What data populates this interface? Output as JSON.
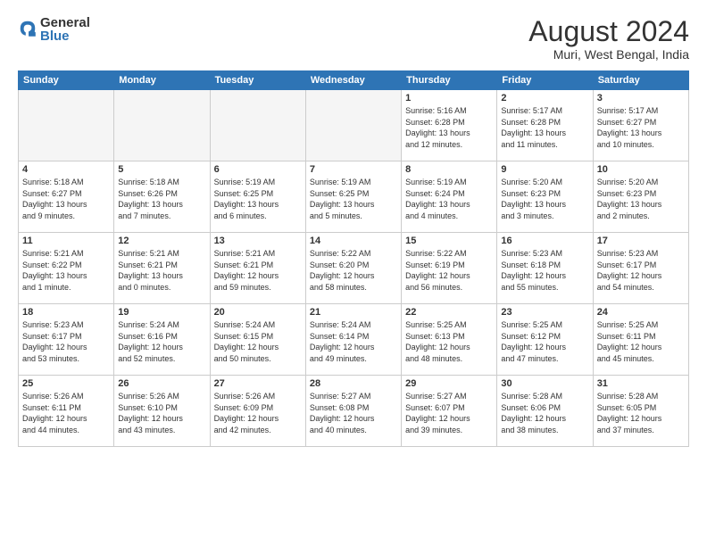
{
  "header": {
    "logo_general": "General",
    "logo_blue": "Blue",
    "title": "August 2024",
    "location": "Muri, West Bengal, India"
  },
  "weekdays": [
    "Sunday",
    "Monday",
    "Tuesday",
    "Wednesday",
    "Thursday",
    "Friday",
    "Saturday"
  ],
  "weeks": [
    [
      {
        "day": "",
        "info": ""
      },
      {
        "day": "",
        "info": ""
      },
      {
        "day": "",
        "info": ""
      },
      {
        "day": "",
        "info": ""
      },
      {
        "day": "1",
        "info": "Sunrise: 5:16 AM\nSunset: 6:28 PM\nDaylight: 13 hours\nand 12 minutes."
      },
      {
        "day": "2",
        "info": "Sunrise: 5:17 AM\nSunset: 6:28 PM\nDaylight: 13 hours\nand 11 minutes."
      },
      {
        "day": "3",
        "info": "Sunrise: 5:17 AM\nSunset: 6:27 PM\nDaylight: 13 hours\nand 10 minutes."
      }
    ],
    [
      {
        "day": "4",
        "info": "Sunrise: 5:18 AM\nSunset: 6:27 PM\nDaylight: 13 hours\nand 9 minutes."
      },
      {
        "day": "5",
        "info": "Sunrise: 5:18 AM\nSunset: 6:26 PM\nDaylight: 13 hours\nand 7 minutes."
      },
      {
        "day": "6",
        "info": "Sunrise: 5:19 AM\nSunset: 6:25 PM\nDaylight: 13 hours\nand 6 minutes."
      },
      {
        "day": "7",
        "info": "Sunrise: 5:19 AM\nSunset: 6:25 PM\nDaylight: 13 hours\nand 5 minutes."
      },
      {
        "day": "8",
        "info": "Sunrise: 5:19 AM\nSunset: 6:24 PM\nDaylight: 13 hours\nand 4 minutes."
      },
      {
        "day": "9",
        "info": "Sunrise: 5:20 AM\nSunset: 6:23 PM\nDaylight: 13 hours\nand 3 minutes."
      },
      {
        "day": "10",
        "info": "Sunrise: 5:20 AM\nSunset: 6:23 PM\nDaylight: 13 hours\nand 2 minutes."
      }
    ],
    [
      {
        "day": "11",
        "info": "Sunrise: 5:21 AM\nSunset: 6:22 PM\nDaylight: 13 hours\nand 1 minute."
      },
      {
        "day": "12",
        "info": "Sunrise: 5:21 AM\nSunset: 6:21 PM\nDaylight: 13 hours\nand 0 minutes."
      },
      {
        "day": "13",
        "info": "Sunrise: 5:21 AM\nSunset: 6:21 PM\nDaylight: 12 hours\nand 59 minutes."
      },
      {
        "day": "14",
        "info": "Sunrise: 5:22 AM\nSunset: 6:20 PM\nDaylight: 12 hours\nand 58 minutes."
      },
      {
        "day": "15",
        "info": "Sunrise: 5:22 AM\nSunset: 6:19 PM\nDaylight: 12 hours\nand 56 minutes."
      },
      {
        "day": "16",
        "info": "Sunrise: 5:23 AM\nSunset: 6:18 PM\nDaylight: 12 hours\nand 55 minutes."
      },
      {
        "day": "17",
        "info": "Sunrise: 5:23 AM\nSunset: 6:17 PM\nDaylight: 12 hours\nand 54 minutes."
      }
    ],
    [
      {
        "day": "18",
        "info": "Sunrise: 5:23 AM\nSunset: 6:17 PM\nDaylight: 12 hours\nand 53 minutes."
      },
      {
        "day": "19",
        "info": "Sunrise: 5:24 AM\nSunset: 6:16 PM\nDaylight: 12 hours\nand 52 minutes."
      },
      {
        "day": "20",
        "info": "Sunrise: 5:24 AM\nSunset: 6:15 PM\nDaylight: 12 hours\nand 50 minutes."
      },
      {
        "day": "21",
        "info": "Sunrise: 5:24 AM\nSunset: 6:14 PM\nDaylight: 12 hours\nand 49 minutes."
      },
      {
        "day": "22",
        "info": "Sunrise: 5:25 AM\nSunset: 6:13 PM\nDaylight: 12 hours\nand 48 minutes."
      },
      {
        "day": "23",
        "info": "Sunrise: 5:25 AM\nSunset: 6:12 PM\nDaylight: 12 hours\nand 47 minutes."
      },
      {
        "day": "24",
        "info": "Sunrise: 5:25 AM\nSunset: 6:11 PM\nDaylight: 12 hours\nand 45 minutes."
      }
    ],
    [
      {
        "day": "25",
        "info": "Sunrise: 5:26 AM\nSunset: 6:11 PM\nDaylight: 12 hours\nand 44 minutes."
      },
      {
        "day": "26",
        "info": "Sunrise: 5:26 AM\nSunset: 6:10 PM\nDaylight: 12 hours\nand 43 minutes."
      },
      {
        "day": "27",
        "info": "Sunrise: 5:26 AM\nSunset: 6:09 PM\nDaylight: 12 hours\nand 42 minutes."
      },
      {
        "day": "28",
        "info": "Sunrise: 5:27 AM\nSunset: 6:08 PM\nDaylight: 12 hours\nand 40 minutes."
      },
      {
        "day": "29",
        "info": "Sunrise: 5:27 AM\nSunset: 6:07 PM\nDaylight: 12 hours\nand 39 minutes."
      },
      {
        "day": "30",
        "info": "Sunrise: 5:28 AM\nSunset: 6:06 PM\nDaylight: 12 hours\nand 38 minutes."
      },
      {
        "day": "31",
        "info": "Sunrise: 5:28 AM\nSunset: 6:05 PM\nDaylight: 12 hours\nand 37 minutes."
      }
    ]
  ]
}
